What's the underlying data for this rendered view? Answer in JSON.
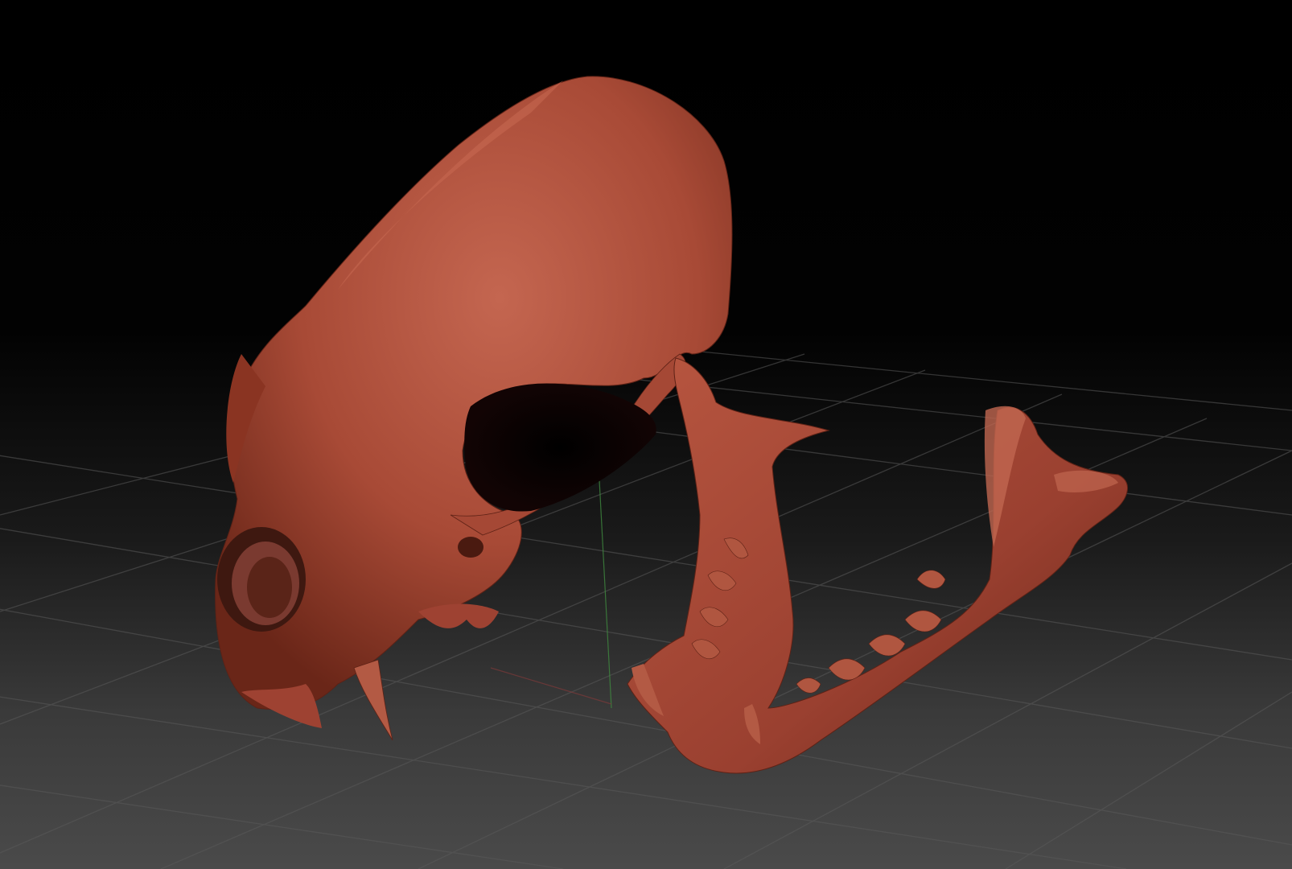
{
  "scene": {
    "background_top": "#000000",
    "background_bottom": "#4a4a4a",
    "grid_color": "#5a5a5a",
    "axis_green": "#3f8a3f",
    "axis_red": "#8a3a3a",
    "model_color": "#a84a36",
    "model_shadow": "#5e2216",
    "model_highlight": "#c96a52",
    "subject": "skull-with-open-jaw"
  }
}
